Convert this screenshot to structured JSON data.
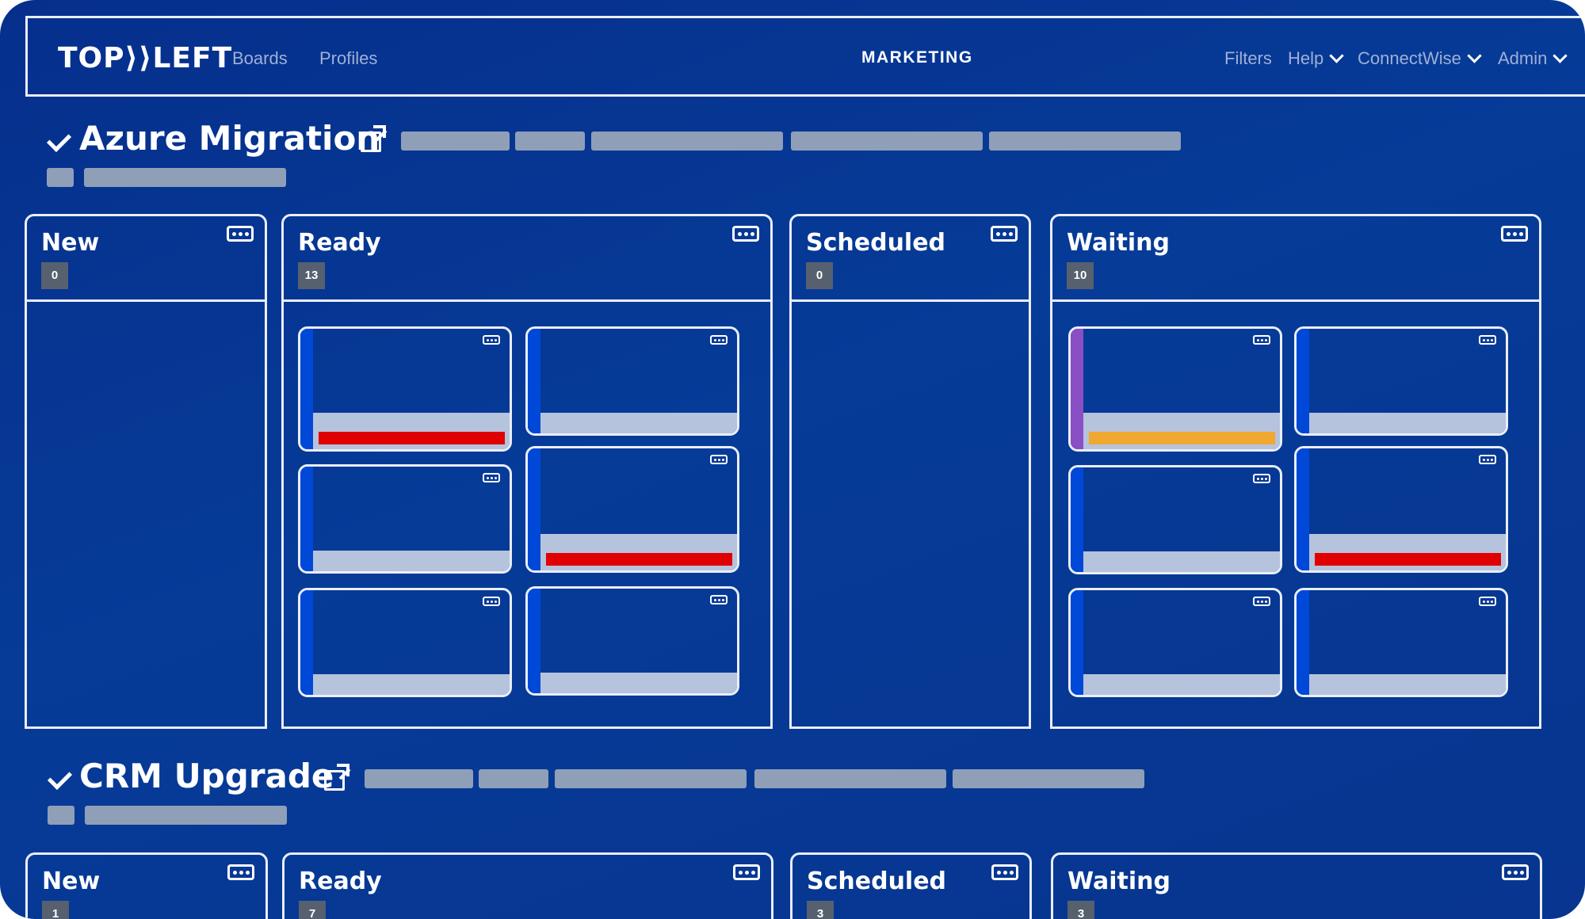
{
  "nav": {
    "logo": "TOP⟩⟩LEFT",
    "links": [
      "Boards",
      "Profiles"
    ],
    "center": "MARKETING",
    "right": [
      "Filters",
      "Help",
      "ConnectWise",
      "Admin"
    ]
  },
  "colors": {
    "background": "#063b98",
    "accent_blue": "#0048d8",
    "accent_purple": "#8a4fc4",
    "alert_red": "#e00000",
    "alert_orange": "#f0a830",
    "placeholder_gray": "#8f9fb8"
  },
  "projects": [
    {
      "title": "Azure Migration",
      "columns": [
        {
          "title": "New",
          "count": "0"
        },
        {
          "title": "Ready",
          "count": "13"
        },
        {
          "title": "Scheduled",
          "count": "0"
        },
        {
          "title": "Waiting",
          "count": "10"
        }
      ]
    },
    {
      "title": "CRM Upgrade",
      "columns": [
        {
          "title": "New",
          "count": "1"
        },
        {
          "title": "Ready",
          "count": "7"
        },
        {
          "title": "Scheduled",
          "count": "3"
        },
        {
          "title": "Waiting",
          "count": "3"
        }
      ]
    }
  ],
  "icons": [
    "check-icon",
    "external-link-icon",
    "more-options-icon",
    "chevron-down-icon"
  ]
}
